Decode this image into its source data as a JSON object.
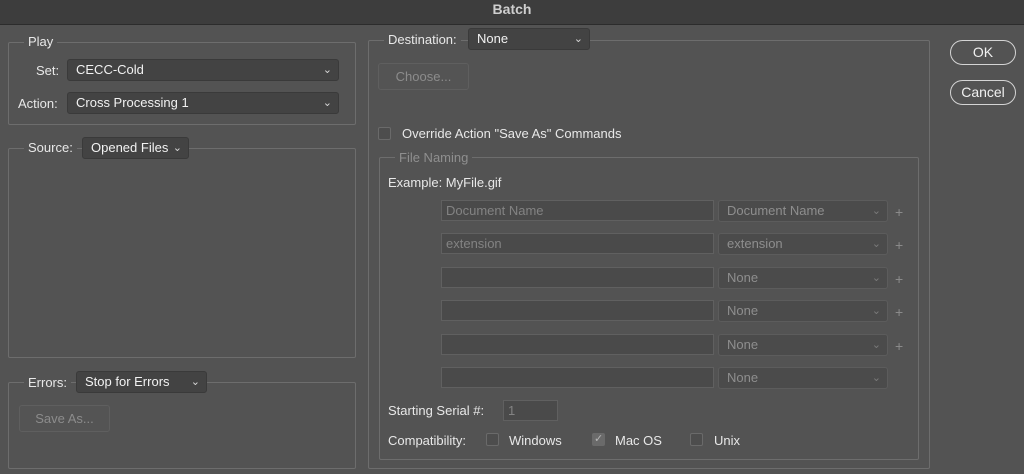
{
  "window": {
    "title": "Batch"
  },
  "play": {
    "legend": "Play",
    "set_label": "Set:",
    "set_value": "CECC-Cold",
    "action_label": "Action:",
    "action_value": "Cross Processing 1"
  },
  "source": {
    "label": "Source:",
    "value": "Opened Files"
  },
  "errors": {
    "label": "Errors:",
    "value": "Stop for Errors",
    "save_as_label": "Save As..."
  },
  "destination": {
    "label": "Destination:",
    "value": "None",
    "choose_label": "Choose...",
    "override_label": "Override Action \"Save As\" Commands",
    "override_checked": false
  },
  "file_naming": {
    "legend": "File Naming",
    "example": "Example: MyFile.gif",
    "rows": [
      {
        "field": "Document Name",
        "select": "Document Name",
        "plus": "+"
      },
      {
        "field": "extension",
        "select": "extension",
        "plus": "+"
      },
      {
        "field": "",
        "select": "None",
        "plus": "+"
      },
      {
        "field": "",
        "select": "None",
        "plus": "+"
      },
      {
        "field": "",
        "select": "None",
        "plus": "+"
      },
      {
        "field": "",
        "select": "None",
        "plus": ""
      }
    ],
    "serial_label": "Starting Serial #:",
    "serial_value": "1",
    "compat_label": "Compatibility:",
    "compat": [
      {
        "label": "Windows",
        "checked": false
      },
      {
        "label": "Mac OS",
        "checked": true
      },
      {
        "label": "Unix",
        "checked": false
      }
    ]
  },
  "buttons": {
    "ok": "OK",
    "cancel": "Cancel"
  },
  "icons": {
    "chevron": "chevron-down-icon",
    "check": "checkmark-icon",
    "plus": "plus-icon"
  }
}
